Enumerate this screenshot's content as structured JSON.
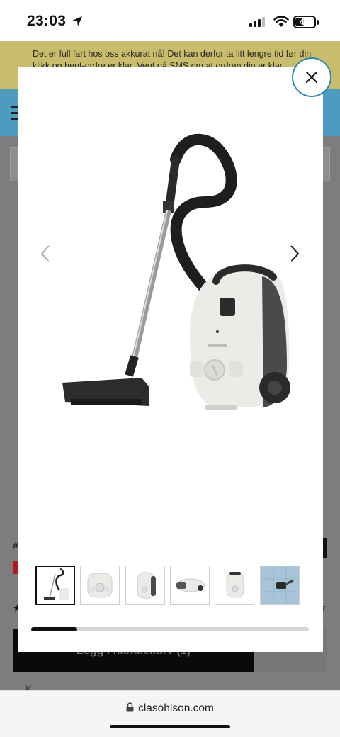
{
  "status_bar": {
    "time": "23:03",
    "battery_level": "47",
    "battery_fraction": 0.47
  },
  "banner": {
    "text": "Det er full fart hos oss akkurat nå! Det kan derfor ta litt lengre tid før din klikk og hent-ordre er klar. Vent på SMS om at ordren din er klar."
  },
  "background": {
    "add_to_cart_label": "Legg i handlekurv (1)",
    "qty_minus": "-",
    "qty_plus": "+",
    "text_snippet": "K...",
    "rating_count": "7"
  },
  "modal": {
    "close_label": "Lukk",
    "thumbnails": [
      {
        "name": "vacuum-full"
      },
      {
        "name": "vacuum-top"
      },
      {
        "name": "vacuum-front"
      },
      {
        "name": "vacuum-side"
      },
      {
        "name": "vacuum-front-2"
      },
      {
        "name": "vacuum-nozzle"
      }
    ],
    "progress_fraction": 0.167
  },
  "browser": {
    "url": "clasohlson.com"
  },
  "colors": {
    "banner": "#c9bc6a",
    "header": "#4d9cbf",
    "close_border": "#2f86b4"
  }
}
